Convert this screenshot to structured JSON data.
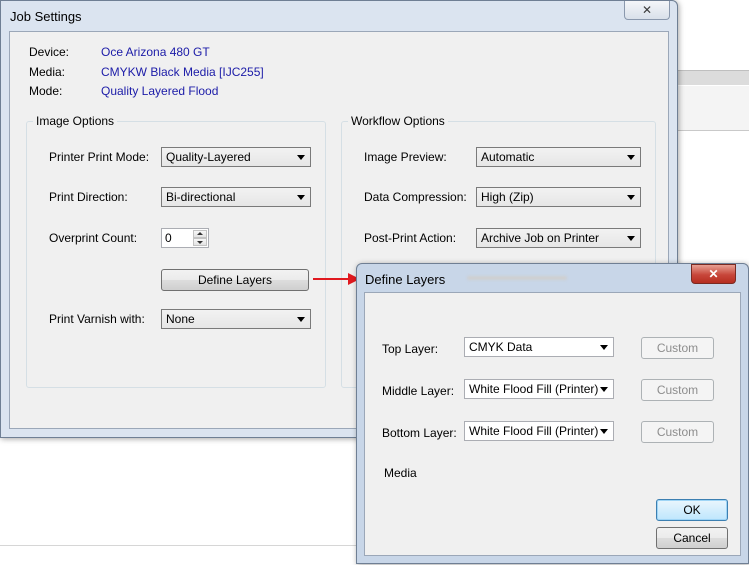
{
  "job_settings": {
    "title": "Job Settings",
    "close_glyph": "✕",
    "info": [
      {
        "label": "Device:",
        "value": "Oce Arizona 480 GT"
      },
      {
        "label": "Media:",
        "value": "CMYKW Black Media [IJC255]"
      },
      {
        "label": "Mode:",
        "value": "Quality Layered Flood"
      }
    ],
    "image_options": {
      "legend": "Image Options",
      "printer_print_mode_label": "Printer Print Mode:",
      "printer_print_mode_value": "Quality-Layered",
      "print_direction_label": "Print Direction:",
      "print_direction_value": "Bi-directional",
      "overprint_count_label": "Overprint Count:",
      "overprint_count_value": "0",
      "define_layers_button": "Define Layers",
      "print_varnish_label": "Print Varnish with:",
      "print_varnish_value": "None"
    },
    "workflow_options": {
      "legend": "Workflow Options",
      "image_preview_label": "Image Preview:",
      "image_preview_value": "Automatic",
      "data_compression_label": "Data Compression:",
      "data_compression_value": "High (Zip)",
      "post_print_action_label": "Post-Print Action:",
      "post_print_action_value": "Archive Job on Printer"
    }
  },
  "define_layers": {
    "title": "Define Layers",
    "close_glyph": "✕",
    "top_layer_label": "Top Layer:",
    "top_layer_value": "CMYK Data",
    "middle_layer_label": "Middle Layer:",
    "middle_layer_value": "White Flood Fill (Printer)",
    "bottom_layer_label": "Bottom Layer:",
    "bottom_layer_value": "White Flood Fill (Printer)",
    "custom_label": "Custom",
    "media_label": "Media",
    "ok_label": "OK",
    "cancel_label": "Cancel"
  },
  "colors": {
    "info_value": "#1c1ca8",
    "annotation_arrow": "#e0191f"
  }
}
